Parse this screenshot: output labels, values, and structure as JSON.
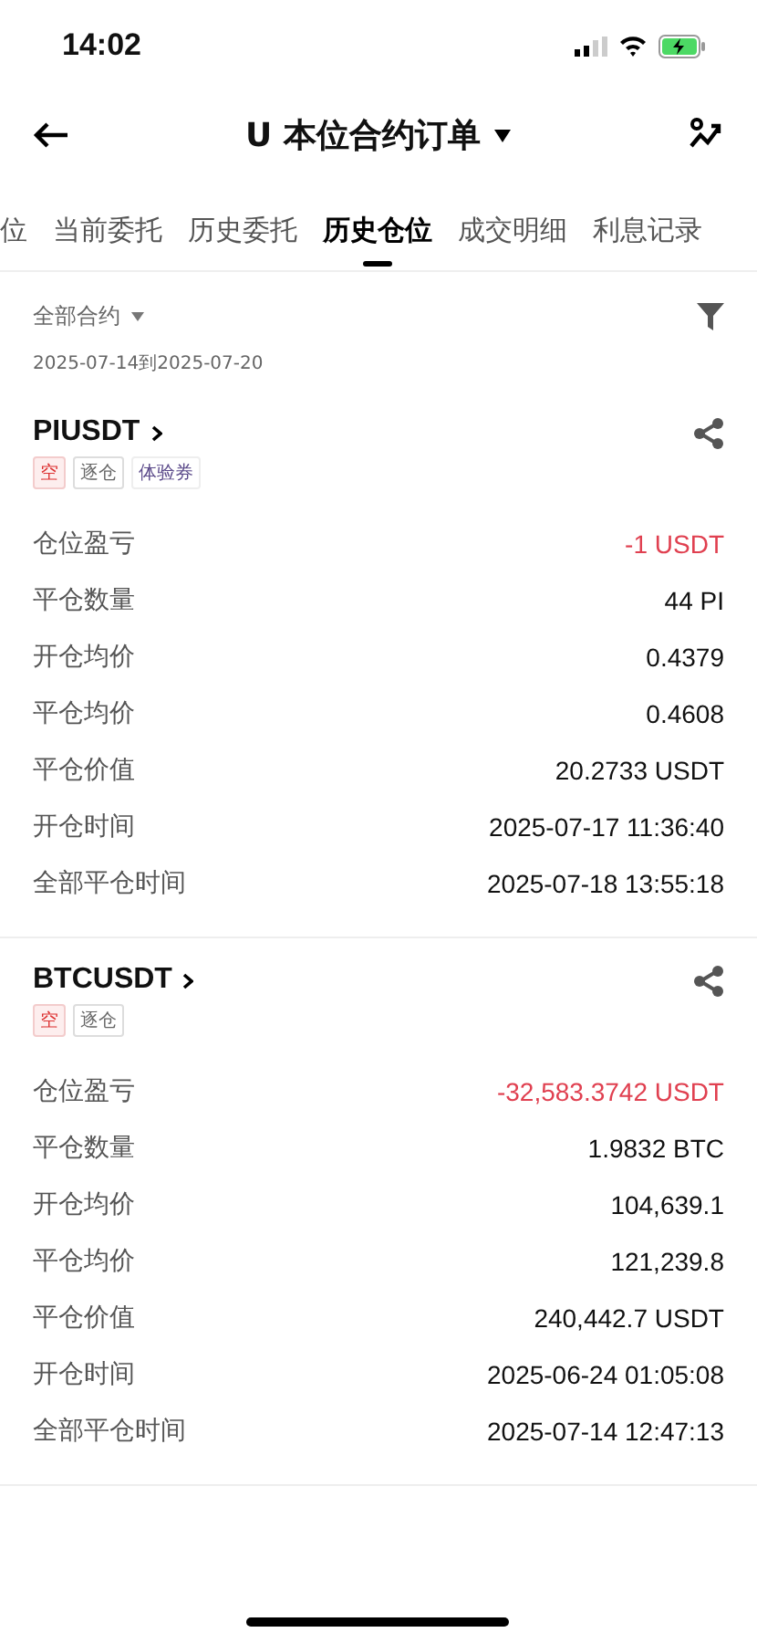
{
  "status_bar": {
    "time": "14:02"
  },
  "header": {
    "title": "U 本位合约订单"
  },
  "tabs": [
    {
      "label": "位",
      "selected": false
    },
    {
      "label": "当前委托",
      "selected": false
    },
    {
      "label": "历史委托",
      "selected": false
    },
    {
      "label": "历史仓位",
      "selected": true
    },
    {
      "label": "成交明细",
      "selected": false
    },
    {
      "label": "利息记录",
      "selected": false
    }
  ],
  "filter": {
    "label": "全部合约",
    "date_range": "2025-07-14到2025-07-20"
  },
  "positions": [
    {
      "symbol": "PIUSDT",
      "tags": [
        {
          "label": "空",
          "kind": "side"
        },
        {
          "label": "逐仓",
          "kind": "mode"
        },
        {
          "label": "体验券",
          "kind": "coupon"
        }
      ],
      "rows": [
        {
          "label": "仓位盈亏",
          "value": "-1 USDT",
          "kind": "loss"
        },
        {
          "label": "平仓数量",
          "value": "44 PI",
          "kind": "plain"
        },
        {
          "label": "开仓均价",
          "value": "0.4379",
          "kind": "plain"
        },
        {
          "label": "平仓均价",
          "value": "0.4608",
          "kind": "plain"
        },
        {
          "label": "平仓价值",
          "value": "20.2733 USDT",
          "kind": "plain"
        },
        {
          "label": "开仓时间",
          "value": "2025-07-17 11:36:40",
          "kind": "plain"
        },
        {
          "label": "全部平仓时间",
          "value": "2025-07-18 13:55:18",
          "kind": "plain"
        }
      ]
    },
    {
      "symbol": "BTCUSDT",
      "tags": [
        {
          "label": "空",
          "kind": "side"
        },
        {
          "label": "逐仓",
          "kind": "mode"
        }
      ],
      "rows": [
        {
          "label": "仓位盈亏",
          "value": "-32,583.3742 USDT",
          "kind": "loss"
        },
        {
          "label": "平仓数量",
          "value": "1.9832 BTC",
          "kind": "plain"
        },
        {
          "label": "开仓均价",
          "value": "104,639.1",
          "kind": "plain"
        },
        {
          "label": "平仓均价",
          "value": "121,239.8",
          "kind": "plain"
        },
        {
          "label": "平仓价值",
          "value": "240,442.7 USDT",
          "kind": "plain"
        },
        {
          "label": "开仓时间",
          "value": "2025-06-24 01:05:08",
          "kind": "plain"
        },
        {
          "label": "全部平仓时间",
          "value": "2025-07-14 12:47:13",
          "kind": "plain"
        }
      ]
    }
  ]
}
